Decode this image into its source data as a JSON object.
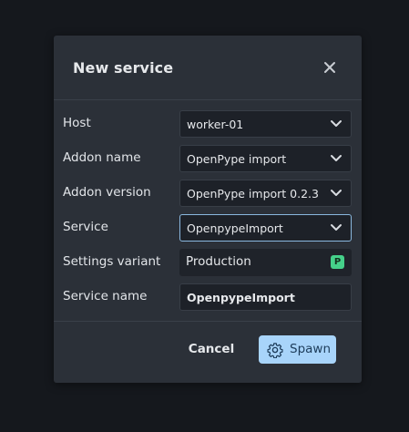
{
  "dialog": {
    "title": "New service"
  },
  "form": {
    "host": {
      "label": "Host",
      "value": "worker-01"
    },
    "addon_name": {
      "label": "Addon name",
      "value": "OpenPype import"
    },
    "addon_version": {
      "label": "Addon version",
      "value": "OpenPype import 0.2.3"
    },
    "service": {
      "label": "Service",
      "value": "OpenpypeImport"
    },
    "settings_variant": {
      "label": "Settings variant",
      "value": "Production",
      "badge": "P",
      "badge_color": "#45d08a"
    },
    "service_name": {
      "label": "Service name",
      "value": "OpenpypeImport"
    }
  },
  "footer": {
    "cancel_label": "Cancel",
    "spawn_label": "Spawn",
    "spawn_icon": "gear-icon",
    "accent_color": "#a8d4fa"
  },
  "icons": {
    "close": "close-icon",
    "dropdown": "chevron-down-icon"
  }
}
